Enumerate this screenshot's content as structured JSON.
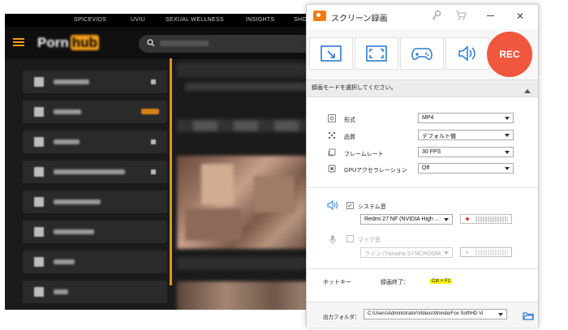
{
  "browser": {
    "top_nav": [
      "SPICEVIDS",
      "UVIU",
      "SEXUAL WELLNESS",
      "INSIGHTS",
      "SHOP"
    ],
    "logo_text": "Porn",
    "logo_highlight": "hub"
  },
  "recorder": {
    "title": "スクリーン録画",
    "rec_label": "REC",
    "mode_prompt": "録画モードを選択してください。",
    "settings": {
      "format_label": "形式",
      "format_value": "MP4",
      "quality_label": "品質",
      "quality_value": "デフォルト値",
      "framerate_label": "フレームレート",
      "framerate_value": "30 FPS",
      "gpu_label": "GPUアクセラレーション",
      "gpu_value": "Off"
    },
    "audio": {
      "system_label": "システム音",
      "system_checked": true,
      "system_device": "Redmi 27 NF (NVIDIA High ...",
      "mic_label": "マイク音",
      "mic_checked": false,
      "mic_device": "ライン (Yamaha SYNCROOM..."
    },
    "hotkey": {
      "label": "ホットキー",
      "end_label": "録画終了：",
      "end_shortcut": "Ctrl + F1"
    },
    "output": {
      "label": "出力フォルダ：",
      "path": "C:\\Users\\Administrator\\Videos\\WonderFox Soft\\HD Vi"
    },
    "colors": {
      "rec": "#f0573e",
      "accent": "#2b7bd1",
      "highlight": "#f8f000"
    }
  }
}
